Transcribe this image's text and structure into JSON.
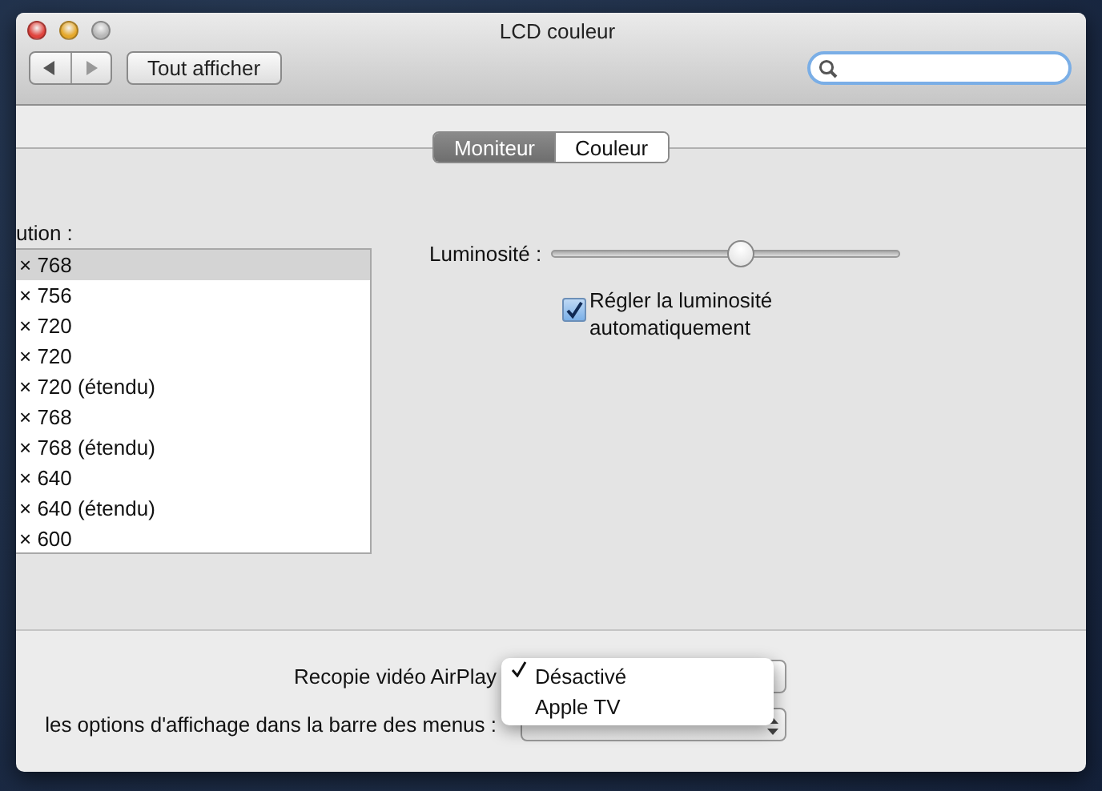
{
  "window": {
    "title": "LCD couleur"
  },
  "toolbar": {
    "show_all_button": "Tout afficher"
  },
  "tabs": [
    {
      "label": "Moniteur",
      "selected": true
    },
    {
      "label": "Couleur",
      "selected": false
    }
  ],
  "resolutions": {
    "label": "ution :",
    "items": [
      {
        "text": "× 768",
        "selected": true
      },
      {
        "text": "× 756",
        "selected": false
      },
      {
        "text": "× 720",
        "selected": false
      },
      {
        "text": "× 720",
        "selected": false
      },
      {
        "text": "× 720 (étendu)",
        "selected": false
      },
      {
        "text": "× 768",
        "selected": false
      },
      {
        "text": "× 768 (étendu)",
        "selected": false
      },
      {
        "text": "× 640",
        "selected": false
      },
      {
        "text": "× 640 (étendu)",
        "selected": false
      },
      {
        "text": "× 600",
        "selected": false
      }
    ]
  },
  "brightness": {
    "label": "Luminosité :",
    "level": 0.545
  },
  "auto_brightness": {
    "label": "Régler la luminosité automatiquement",
    "checked": true
  },
  "airplay": {
    "label": "Recopie vidéo AirPlay",
    "menu": [
      {
        "label": "Désactivé",
        "selected": true
      },
      {
        "label": "Apple TV",
        "selected": false
      }
    ]
  },
  "menu_bar_options": {
    "label": "les options d'affichage dans la barre des menus :"
  }
}
